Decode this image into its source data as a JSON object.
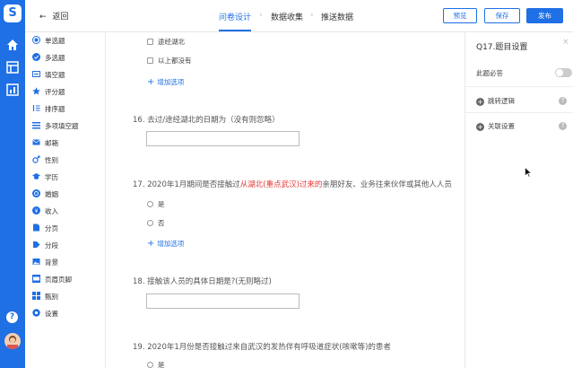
{
  "header": {
    "back_label": "返回",
    "steps": [
      "问卷设计",
      "数据收集",
      "推送数据"
    ],
    "active_step": 0,
    "buttons": {
      "preview": "预览",
      "save": "保存",
      "publish": "发布"
    }
  },
  "sidebar": {
    "items": [
      {
        "label": "单选题",
        "icon": "radio-icon"
      },
      {
        "label": "多选题",
        "icon": "checkbox-icon"
      },
      {
        "label": "填空题",
        "icon": "fill-blank-icon"
      },
      {
        "label": "评分题",
        "icon": "star-icon"
      },
      {
        "label": "排序题",
        "icon": "sort-icon"
      },
      {
        "label": "多项填空题",
        "icon": "multi-fill-icon"
      },
      {
        "label": "邮箱",
        "icon": "mail-icon"
      },
      {
        "label": "性别",
        "icon": "gender-icon"
      },
      {
        "label": "学历",
        "icon": "education-icon"
      },
      {
        "label": "婚姻",
        "icon": "marriage-icon"
      },
      {
        "label": "收入",
        "icon": "income-icon"
      },
      {
        "label": "分页",
        "icon": "page-break-icon"
      },
      {
        "label": "分段",
        "icon": "section-icon"
      },
      {
        "label": "背景",
        "icon": "background-icon"
      },
      {
        "label": "页眉页脚",
        "icon": "header-footer-icon"
      },
      {
        "label": "甄别",
        "icon": "screening-icon"
      },
      {
        "label": "设置",
        "icon": "settings-icon"
      }
    ]
  },
  "canvas": {
    "prev_options": [
      "途经湖北",
      "以上都没有"
    ],
    "add_option": "增加选项",
    "q16": "16. 去过/途经湖北的日期为（没有则忽略）",
    "q17_pre": "17. 2020年1月期间是否接触过",
    "q17_red": "从湖北(重点武汉)过来的",
    "q17_post": "亲朋好友、业务往来伙伴或其他人人员",
    "q17_options": [
      "是",
      "否"
    ],
    "q18": "18. 接触该人员的具体日期是?(无则略过)",
    "q19": "19. 2020年1月份是否接触过来自武汉的发热伴有呼吸道症状(咳嗽等)的患者",
    "q19_options": [
      "是"
    ]
  },
  "panel": {
    "title": "Q17.题目设置",
    "required_label": "此题必答",
    "required": false,
    "jump_logic": "跳转逻辑",
    "link_settings": "关联设置"
  },
  "colors": {
    "brand": "#1f6fe5",
    "highlight": "#e53935"
  }
}
